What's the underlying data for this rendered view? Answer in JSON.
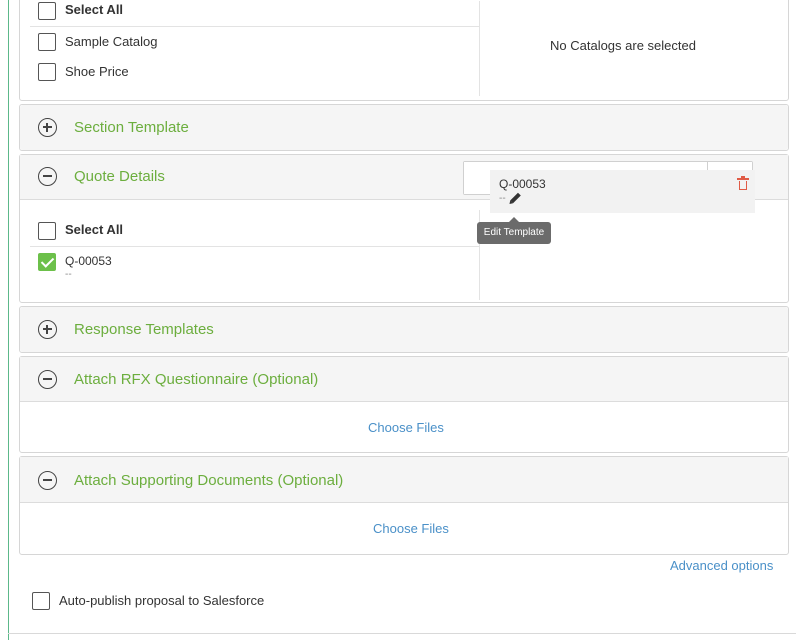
{
  "catalogs": {
    "select_all_label": "Select All",
    "items": [
      {
        "label": "Sample Catalog",
        "checked": false
      },
      {
        "label": "Shoe Price",
        "checked": false
      }
    ],
    "empty_message": "No Catalogs are selected"
  },
  "section_template": {
    "title": "Section Template",
    "expanded": false,
    "icon": "plus-circle-icon"
  },
  "quote_details": {
    "title": "Quote Details",
    "expanded": true,
    "icon": "minus-circle-icon",
    "search": {
      "value": "",
      "placeholder": ""
    },
    "select_all_label": "Select All",
    "items": [
      {
        "label": "Q-00053",
        "sub": "--",
        "checked": true
      }
    ],
    "selected": [
      {
        "label": "Q-00053",
        "sub": "--"
      }
    ],
    "tooltip": "Edit Template"
  },
  "response_templates": {
    "title": "Response Templates",
    "expanded": false,
    "icon": "plus-circle-icon"
  },
  "rfx_questionnaire": {
    "title": "Attach RFX Questionnaire (Optional)",
    "expanded": true,
    "icon": "minus-circle-icon",
    "choose_files_label": "Choose Files"
  },
  "supporting_documents": {
    "title": "Attach Supporting Documents (Optional)",
    "expanded": true,
    "icon": "minus-circle-icon",
    "choose_files_label": "Choose Files"
  },
  "advanced_options_label": "Advanced options",
  "auto_publish": {
    "label": "Auto-publish proposal to Salesforce",
    "checked": false
  },
  "colors": {
    "accent_green": "#6cae3e",
    "link_blue": "#4a90c8",
    "check_green": "#6cc04a",
    "delete_red": "#e05b46"
  }
}
